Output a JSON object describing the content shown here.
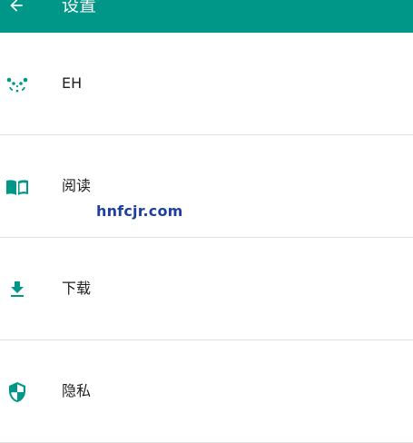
{
  "appbar": {
    "title": "设置",
    "color": "#009688"
  },
  "items": [
    {
      "label": "EH",
      "icon": "panda-icon"
    },
    {
      "label": "阅读",
      "icon": "book-icon"
    },
    {
      "label": "下载",
      "icon": "download-icon"
    },
    {
      "label": "隐私",
      "icon": "shield-icon"
    }
  ],
  "watermark": "hnfcjr.com",
  "colors": {
    "accent": "#009688",
    "divider": "#e0e0e0",
    "text": "#212121"
  }
}
